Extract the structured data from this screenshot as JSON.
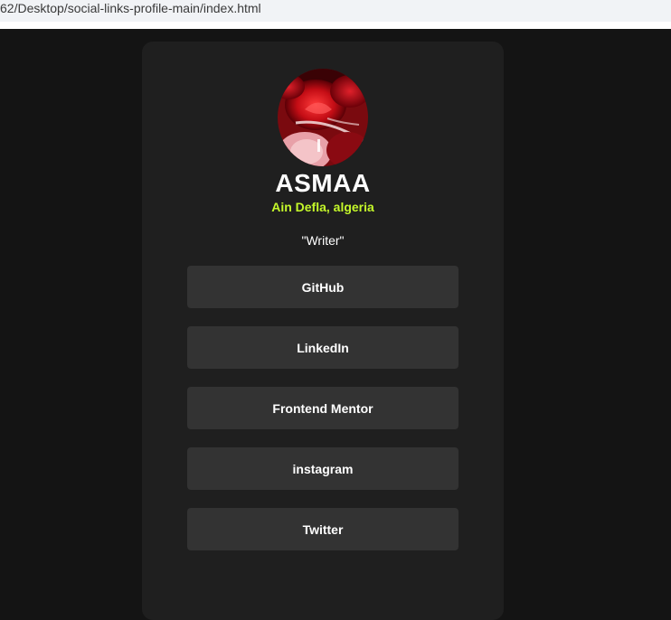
{
  "browser": {
    "address": "62/Desktop/social-links-profile-main/index.html"
  },
  "profile": {
    "name": "ASMAA",
    "location": "Ain Defla, algeria",
    "bio": "\"Writer\"",
    "avatar_icon": "profile-photo-red-roses"
  },
  "links": [
    {
      "label": "GitHub"
    },
    {
      "label": "LinkedIn"
    },
    {
      "label": "Frontend Mentor"
    },
    {
      "label": "instagram"
    },
    {
      "label": "Twitter"
    }
  ],
  "colors": {
    "page_background": "#141414",
    "card_background": "#1f1f1f",
    "button_background": "#333333",
    "accent": "#c4f82a",
    "text": "#ffffff"
  }
}
